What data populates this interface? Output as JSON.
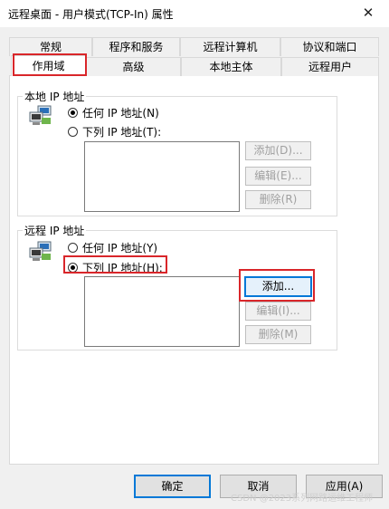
{
  "window": {
    "title": "远程桌面 - 用户模式(TCP-In) 属性",
    "close_glyph": "✕"
  },
  "tabs": {
    "row1": [
      "常规",
      "程序和服务",
      "远程计算机",
      "协议和端口"
    ],
    "row2": [
      "作用域",
      "高级",
      "本地主体",
      "远程用户"
    ],
    "selected": "作用域"
  },
  "local": {
    "group_title": "本地 IP 地址",
    "radio_any": "任何 IP 地址(N)",
    "radio_list": "下列 IP 地址(T):",
    "selected": "any",
    "add": "添加(D)...",
    "edit": "编辑(E)...",
    "remove": "删除(R)"
  },
  "remote": {
    "group_title": "远程 IP 地址",
    "radio_any": "任何 IP 地址(Y)",
    "radio_list": "下列 IP 地址(H):",
    "selected": "list",
    "add": "添加...",
    "edit": "编辑(I)...",
    "remove": "删除(M)"
  },
  "footer": {
    "ok": "确定",
    "cancel": "取消",
    "apply": "应用(A)"
  },
  "watermark": "CSDN @2023系列网路运维工程师"
}
